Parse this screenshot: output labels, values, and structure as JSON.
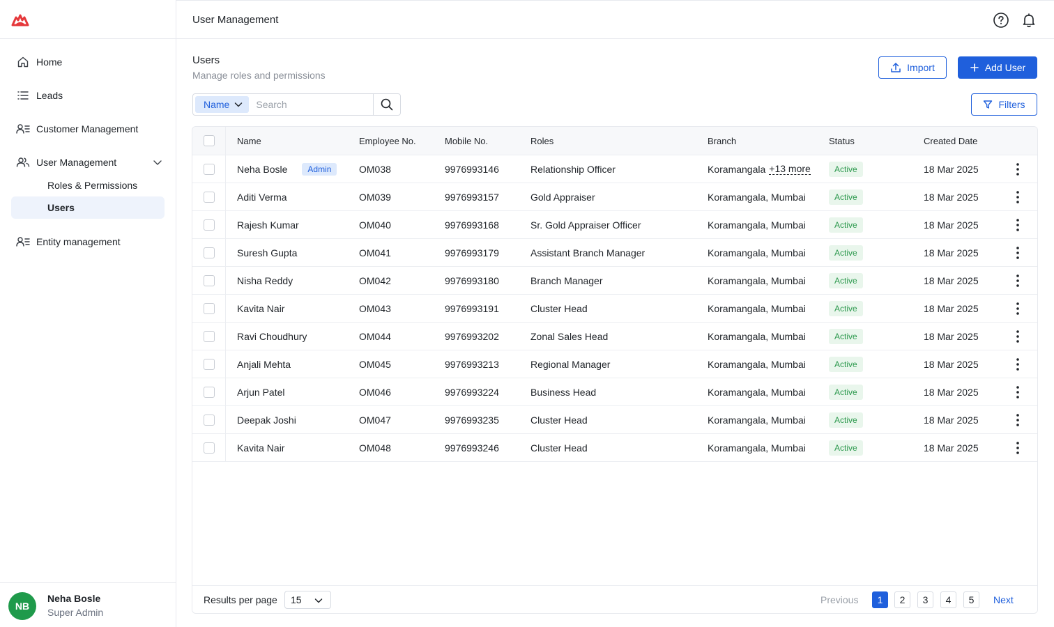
{
  "header": {
    "title": "User Management"
  },
  "sidebar": {
    "items": [
      {
        "label": "Home",
        "icon": "home-icon"
      },
      {
        "label": "Leads",
        "icon": "list-icon"
      },
      {
        "label": "Customer Management",
        "icon": "users-list-icon"
      },
      {
        "label": "User Management",
        "icon": "users-icon",
        "expanded": true,
        "children": [
          {
            "label": "Roles & Permissions"
          },
          {
            "label": "Users",
            "active": true
          }
        ]
      },
      {
        "label": "Entity management",
        "icon": "users-list-icon"
      }
    ],
    "profile": {
      "initials": "NB",
      "name": "Neha Bosle",
      "role": "Super Admin",
      "avatar_color": "#1f9a4b"
    }
  },
  "page": {
    "title": "Users",
    "subtitle": "Manage roles and permissions",
    "import_label": "Import",
    "add_user_label": "Add User",
    "filters_label": "Filters",
    "search_field": "Name",
    "search_placeholder": "Search"
  },
  "table": {
    "columns": [
      "Name",
      "Employee No.",
      "Mobile No.",
      "Roles",
      "Branch",
      "Status",
      "Created Date"
    ],
    "rows": [
      {
        "name": "Neha Bosle",
        "tag": "Admin",
        "emp": "OM038",
        "mobile": "9976993146",
        "role": "Relationship Officer",
        "branch": "Koramangala",
        "branch_more": "+13 more",
        "status": "Active",
        "created": "18 Mar 2025"
      },
      {
        "name": "Aditi Verma",
        "emp": "OM039",
        "mobile": "9976993157",
        "role": "Gold Appraiser",
        "branch": "Koramangala, Mumbai",
        "status": "Active",
        "created": "18 Mar 2025"
      },
      {
        "name": "Rajesh Kumar",
        "emp": "OM040",
        "mobile": "9976993168",
        "role": "Sr. Gold Appraiser Officer",
        "branch": "Koramangala, Mumbai",
        "status": "Active",
        "created": "18 Mar 2025"
      },
      {
        "name": "Suresh Gupta",
        "emp": "OM041",
        "mobile": "9976993179",
        "role": "Assistant Branch Manager",
        "branch": "Koramangala, Mumbai",
        "status": "Active",
        "created": "18 Mar 2025"
      },
      {
        "name": "Nisha Reddy",
        "emp": "OM042",
        "mobile": "9976993180",
        "role": "Branch Manager",
        "branch": "Koramangala, Mumbai",
        "status": "Active",
        "created": "18 Mar 2025"
      },
      {
        "name": "Kavita Nair",
        "emp": "OM043",
        "mobile": "9976993191",
        "role": "Cluster Head",
        "branch": "Koramangala, Mumbai",
        "status": "Active",
        "created": "18 Mar 2025"
      },
      {
        "name": "Ravi Choudhury",
        "emp": "OM044",
        "mobile": "9976993202",
        "role": "Zonal Sales Head",
        "branch": "Koramangala, Mumbai",
        "status": "Active",
        "created": "18 Mar 2025"
      },
      {
        "name": "Anjali Mehta",
        "emp": "OM045",
        "mobile": "9976993213",
        "role": "Regional Manager",
        "branch": "Koramangala, Mumbai",
        "status": "Active",
        "created": "18 Mar 2025"
      },
      {
        "name": "Arjun Patel",
        "emp": "OM046",
        "mobile": "9976993224",
        "role": "Business Head",
        "branch": "Koramangala, Mumbai",
        "status": "Active",
        "created": "18 Mar 2025"
      },
      {
        "name": "Deepak Joshi",
        "emp": "OM047",
        "mobile": "9976993235",
        "role": "Cluster Head",
        "branch": "Koramangala, Mumbai",
        "status": "Active",
        "created": "18 Mar 2025"
      },
      {
        "name": "Kavita Nair",
        "emp": "OM048",
        "mobile": "9976993246",
        "role": "Cluster Head",
        "branch": "Koramangala, Mumbai",
        "status": "Active",
        "created": "18 Mar 2025"
      }
    ]
  },
  "pagination": {
    "results_label": "Results per page",
    "per_page": "15",
    "previous_label": "Previous",
    "next_label": "Next",
    "pages": [
      "1",
      "2",
      "3",
      "4",
      "5"
    ],
    "current": "1"
  },
  "colors": {
    "primary": "#1f5fdc",
    "active_green": "#2e9a4f",
    "brand_red": "#e5383b"
  }
}
